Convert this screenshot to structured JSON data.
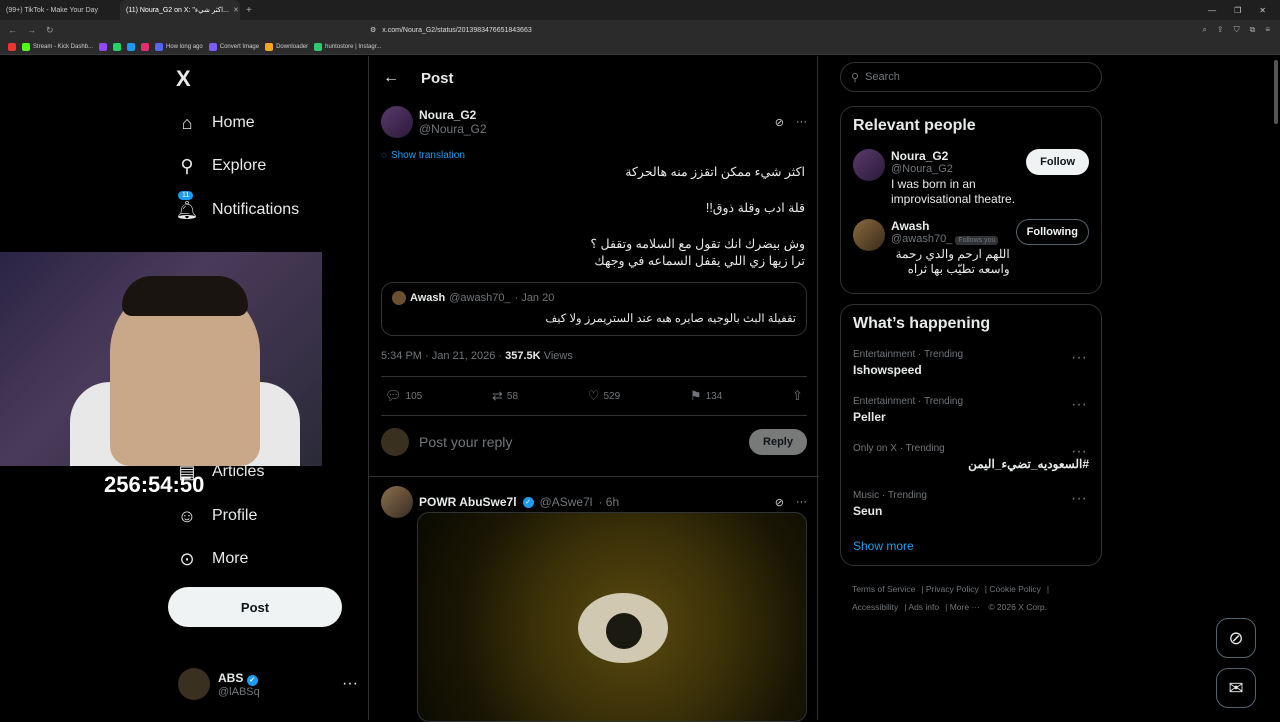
{
  "browser": {
    "tabs": [
      {
        "title": "(99+) TikTok - Make Your Day"
      },
      {
        "title": "(11) Noura_G2 on X: \"اكثر شيء..."
      }
    ],
    "url": "x.com/Noura_G2/status/2013983476651843663",
    "bookmarks": [
      "Stream - Kick Dashb...",
      "How long ago",
      "Convert Image",
      "Downloader",
      "huntostore | Instagr..."
    ]
  },
  "nav": {
    "logo": "X",
    "items": [
      {
        "label": "Home",
        "icon": "home-icon"
      },
      {
        "label": "Explore",
        "icon": "search-icon"
      },
      {
        "label": "Notifications",
        "icon": "bell-icon",
        "badge": "11"
      },
      {
        "label": "Articles",
        "icon": "articles-icon"
      },
      {
        "label": "Profile",
        "icon": "profile-icon"
      },
      {
        "label": "More",
        "icon": "more-icon"
      }
    ],
    "post_button": "Post",
    "account": {
      "name": "ABS",
      "handle": "@lABSq"
    }
  },
  "overlay": {
    "timer": "256:54:50"
  },
  "main": {
    "header": "Post",
    "post": {
      "author": "Noura_G2",
      "handle": "@Noura_G2",
      "show_translation": "Show translation",
      "lines": [
        "اكثر شيء ممكن اتقزز منه هالحركة",
        "قلة ادب وقلة ذوق!!",
        "وش بيضرك انك تقول مع السلامه وتقفل ؟",
        "ترا زيها زي اللي يقفل السماعه في وجهك"
      ],
      "quote": {
        "name": "Awash",
        "handle": "@awash70_",
        "date": "· Jan 20",
        "text": "تقفيلة البث بالوجيه صايره هبه عند الستريمرز ولا كيف"
      },
      "time": "5:34 PM · Jan 21, 2026 · ",
      "views_count": "357.5K",
      "views_label": " Views",
      "replies": "105",
      "reposts": "58",
      "likes": "529",
      "bookmarks": "134"
    },
    "reply_placeholder": "Post your reply",
    "reply_button": "Reply",
    "second_post": {
      "author": "POWR AbuSwe7l",
      "handle": "@ASwe7l",
      "time": "· 6h"
    }
  },
  "sidebar": {
    "search_placeholder": "Search",
    "relevant_title": "Relevant people",
    "people": [
      {
        "name": "Noura_G2",
        "handle": "@Noura_G2",
        "bio": "I was born in an improvisational theatre.",
        "button": "Follow"
      },
      {
        "name": "Awash",
        "handle": "@awash70_",
        "follows_you": "Follows you",
        "bio": "اللهم ارحم والدي رحمة واسعه تطيّب بها ثراه",
        "button": "Following"
      }
    ],
    "happening_title": "What’s happening",
    "trends": [
      {
        "category": "Entertainment · Trending",
        "name": "Ishowspeed"
      },
      {
        "category": "Entertainment · Trending",
        "name": "Peller"
      },
      {
        "category": "Only on X · Trending",
        "name": "#السعوديه_تضيء_اليمن"
      },
      {
        "category": "Music · Trending",
        "name": "Seun"
      }
    ],
    "show_more": "Show more",
    "footer": [
      "Terms of Service",
      "Privacy Policy",
      "Cookie Policy",
      "Accessibility",
      "Ads info",
      "More ···",
      "© 2026 X Corp."
    ]
  }
}
